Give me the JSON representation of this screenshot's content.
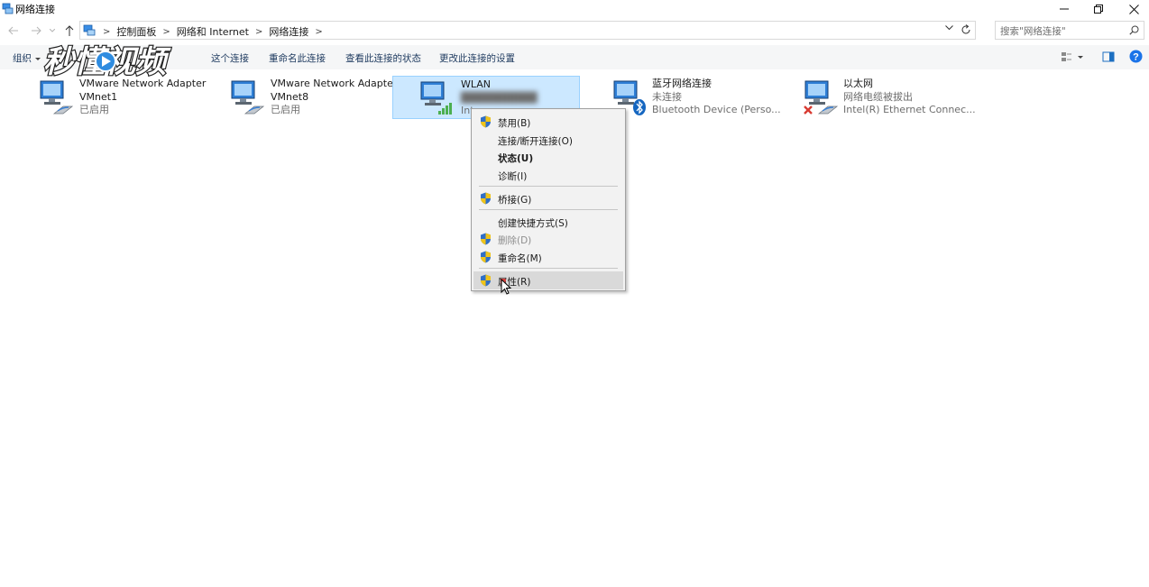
{
  "window": {
    "title": "网络连接"
  },
  "address": {
    "crumbs": [
      "控制面板",
      "网络和 Internet",
      "网络连接"
    ],
    "separator": ">"
  },
  "search": {
    "placeholder": "搜索\"网络连接\""
  },
  "commands": {
    "organize": "组织",
    "disable_partial": "这个连接",
    "rename": "重命名此连接",
    "view_status": "查看此连接的状态",
    "change_settings": "更改此连接的设置"
  },
  "watermark": {
    "text": "秒懂视频"
  },
  "connections": [
    {
      "name": "VMware Network Adapter",
      "name2": "VMnet1",
      "status": "已启用",
      "icon": "network-adapter-icon"
    },
    {
      "name": "VMware Network Adapter",
      "name2": "VMnet8",
      "status": "已启用",
      "icon": "network-adapter-icon"
    },
    {
      "name": "WLAN",
      "status": "",
      "device": "Int",
      "icon": "wireless-signal-icon"
    },
    {
      "name": "蓝牙网络连接",
      "status": "未连接",
      "device": "Bluetooth Device (Perso...",
      "icon": "bluetooth-icon"
    },
    {
      "name": "以太网",
      "status": "网络电缆被拔出",
      "device": "Intel(R) Ethernet Connec...",
      "icon": "ethernet-icon"
    }
  ],
  "context_menu": {
    "items": [
      {
        "label": "禁用(B)",
        "shield": true
      },
      {
        "label": "连接/断开连接(O)",
        "shield": false
      },
      {
        "label": "状态(U)",
        "shield": false,
        "bold": true
      },
      {
        "label": "诊断(I)",
        "shield": false
      },
      {
        "label": "桥接(G)",
        "shield": true
      },
      {
        "label": "创建快捷方式(S)",
        "shield": false
      },
      {
        "label": "删除(D)",
        "shield": true,
        "disabled": true
      },
      {
        "label": "重命名(M)",
        "shield": true
      },
      {
        "label": "属性(R)",
        "shield": true,
        "hovered": true
      }
    ]
  },
  "colors": {
    "selection_bg": "#cce8ff",
    "selection_border": "#99d1ff",
    "command_text": "#1e3a5f",
    "menu_bg": "#f2f2f2",
    "menu_hover": "#d9d9d9",
    "shield_blue": "#2f6fc7",
    "shield_yellow": "#f0c419",
    "error_red": "#d83b32",
    "help_blue": "#1a73e8"
  }
}
